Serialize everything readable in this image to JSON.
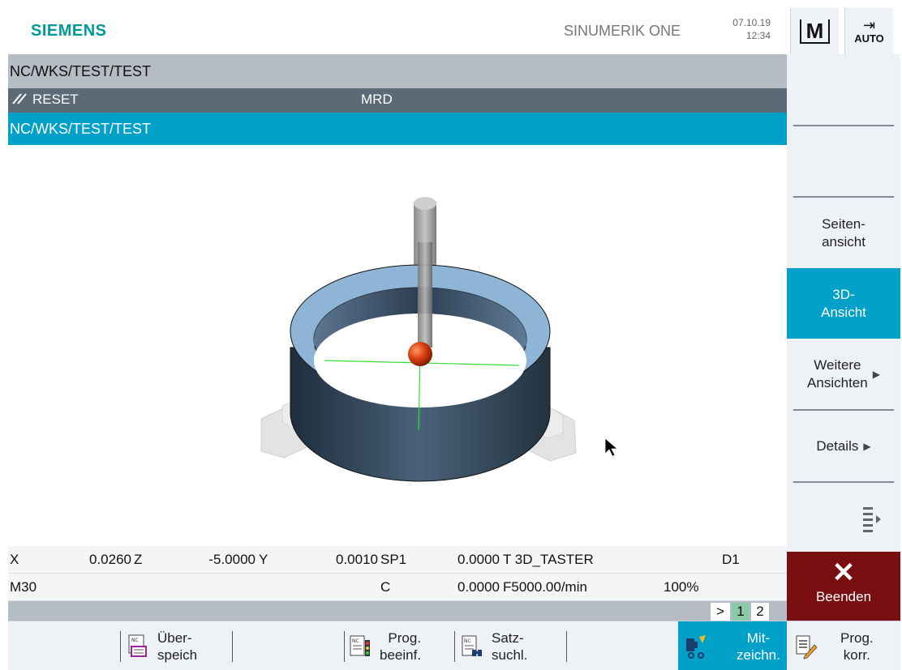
{
  "header": {
    "brand": "SIEMENS",
    "product": "SINUMERIK ONE",
    "date": "07.10.19",
    "time": "12:34",
    "mode_m": "M",
    "mode_auto": "AUTO"
  },
  "path_title": "NC/WKS/TEST/TEST",
  "status": {
    "reset": "RESET",
    "mrd": "MRD"
  },
  "program_name": "NC/WKS/TEST/TEST",
  "positions": {
    "row1": {
      "x_label": "X",
      "x_value": "0.0260",
      "z_label": "Z",
      "z_value": "-5.0000",
      "y_label": "Y",
      "y_value": "0.0010",
      "sp_label": "SP1",
      "sp_value": "0.0000",
      "tool": "T 3D_TASTER",
      "d": "D1"
    },
    "row2": {
      "block": "M30",
      "c_label": "C",
      "c_value": "0.0000",
      "feed": "F5000.00/min",
      "override": "100%"
    }
  },
  "pages": {
    "arrow": ">",
    "p1": "1",
    "p2": "2"
  },
  "softkeys_right": {
    "seitenansicht_1": "Seiten-",
    "seitenansicht_2": "ansicht",
    "ansicht3d_1": "3D-",
    "ansicht3d_2": "Ansicht",
    "weitere_1": "Weitere",
    "weitere_2": "Ansichten",
    "details": "Details",
    "beenden": "Beenden"
  },
  "softkeys_bottom": {
    "ueberspeich_1": "Über-",
    "ueberspeich_2": "speich",
    "prog_beeinf_1": "Prog.",
    "prog_beeinf_2": "beeinf.",
    "satz_1": "Satz-",
    "satz_2": "suchl.",
    "mitzeichn_1": "Mit-",
    "mitzeichn_2": "zeichn.",
    "prog_korr_1": "Prog.",
    "prog_korr_2": "korr."
  },
  "icons": {
    "mode_m": "machine-m-icon",
    "mode_auto": "auto-arrow-icon",
    "reset": "reset-slash-icon",
    "close": "close-x-icon",
    "more": "more-softkeys-icon"
  },
  "colors": {
    "brand": "#009999",
    "active": "#00a0c8",
    "status_bar": "#5c6a78",
    "exit": "#7a0f12"
  }
}
